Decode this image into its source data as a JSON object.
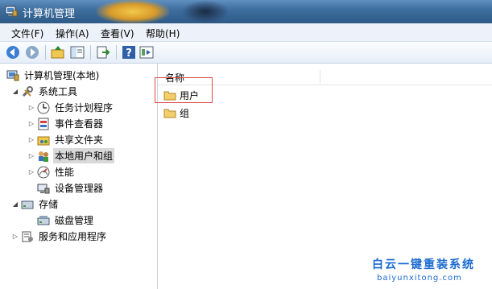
{
  "window": {
    "title": "计算机管理"
  },
  "menu": [
    "文件(F)",
    "操作(A)",
    "查看(V)",
    "帮助(H)"
  ],
  "toolbar": {
    "buttons": [
      "back-icon",
      "forward-icon",
      "up-folder-icon",
      "show-hide-tree-icon",
      "export-list-icon",
      "help-icon",
      "properties-icon"
    ]
  },
  "tree": {
    "root": "计算机管理(本地)",
    "system_tools": "系统工具",
    "task_scheduler": "任务计划程序",
    "event_viewer": "事件查看器",
    "shared_folders": "共享文件夹",
    "local_users_groups": "本地用户和组",
    "performance": "性能",
    "device_manager": "设备管理器",
    "storage": "存储",
    "disk_management": "磁盘管理",
    "services_apps": "服务和应用程序"
  },
  "list": {
    "column_name": "名称",
    "items": [
      "用户",
      "组"
    ]
  },
  "watermark": {
    "line1": "白云一键重装系统",
    "line2": "baiyunxitong.com"
  }
}
